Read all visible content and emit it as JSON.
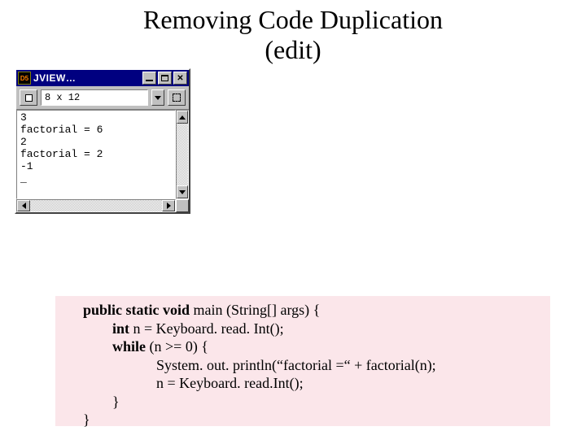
{
  "slide": {
    "title": "Removing Code Duplication\n(edit)"
  },
  "window": {
    "title": "JVIEW…",
    "icon_label": "D5",
    "font_label": "8 x 12",
    "console_lines": [
      "3",
      "factorial = 6",
      "2",
      "factorial = 2",
      "-1",
      "_"
    ]
  },
  "code": {
    "tokens": [
      {
        "t": "public static void",
        "kw": true
      },
      {
        "t": " main (String[] args) {\n"
      },
      {
        "t": "        "
      },
      {
        "t": "int",
        "kw": true
      },
      {
        "t": " n = Keyboard. read. Int();\n"
      },
      {
        "t": "        "
      },
      {
        "t": "while",
        "kw": true
      },
      {
        "t": " (n >= 0) {\n"
      },
      {
        "t": "                    System. out. println(“factorial =“ + factorial(n);\n"
      },
      {
        "t": "                    n = Keyboard. read.Int();\n"
      },
      {
        "t": "        }\n"
      },
      {
        "t": "}"
      }
    ]
  }
}
